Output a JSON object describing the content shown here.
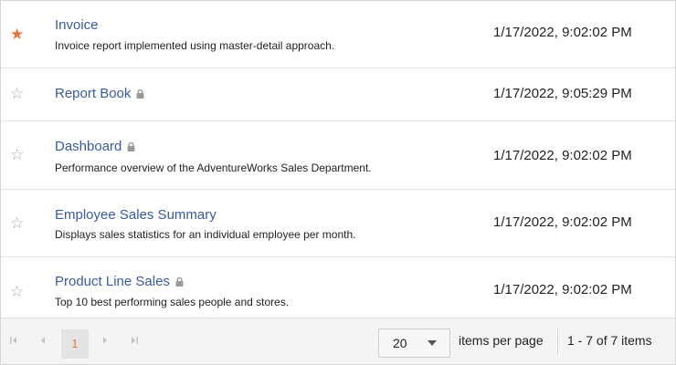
{
  "reports": [
    {
      "title": "Invoice",
      "description": "Invoice report implemented using master-detail approach.",
      "date": "1/17/2022, 9:02:02 PM",
      "favorite": true,
      "locked": false
    },
    {
      "title": "Report Book",
      "description": "",
      "date": "1/17/2022, 9:05:29 PM",
      "favorite": false,
      "locked": true
    },
    {
      "title": "Dashboard",
      "description": "Performance overview of the AdventureWorks Sales Department.",
      "date": "1/17/2022, 9:02:02 PM",
      "favorite": false,
      "locked": true
    },
    {
      "title": "Employee Sales Summary",
      "description": "Displays sales statistics for an individual employee per month.",
      "date": "1/17/2022, 9:02:02 PM",
      "favorite": false,
      "locked": false
    },
    {
      "title": "Product Line Sales",
      "description": "Top 10 best performing sales people and stores.",
      "date": "1/17/2022, 9:02:02 PM",
      "favorite": false,
      "locked": true
    }
  ],
  "icons": {
    "star_filled": "★",
    "star_empty": "☆",
    "first": "⇤",
    "prev": "◀",
    "next": "▶",
    "last": "⇥"
  },
  "colors": {
    "favorite_star": "#e8763a",
    "title_link": "#3a5a9e",
    "current_page": "#e8763a"
  },
  "pager": {
    "current_page": "1",
    "page_size": "20",
    "page_size_label": "items per page",
    "summary": "1 - 7 of 7 items"
  }
}
